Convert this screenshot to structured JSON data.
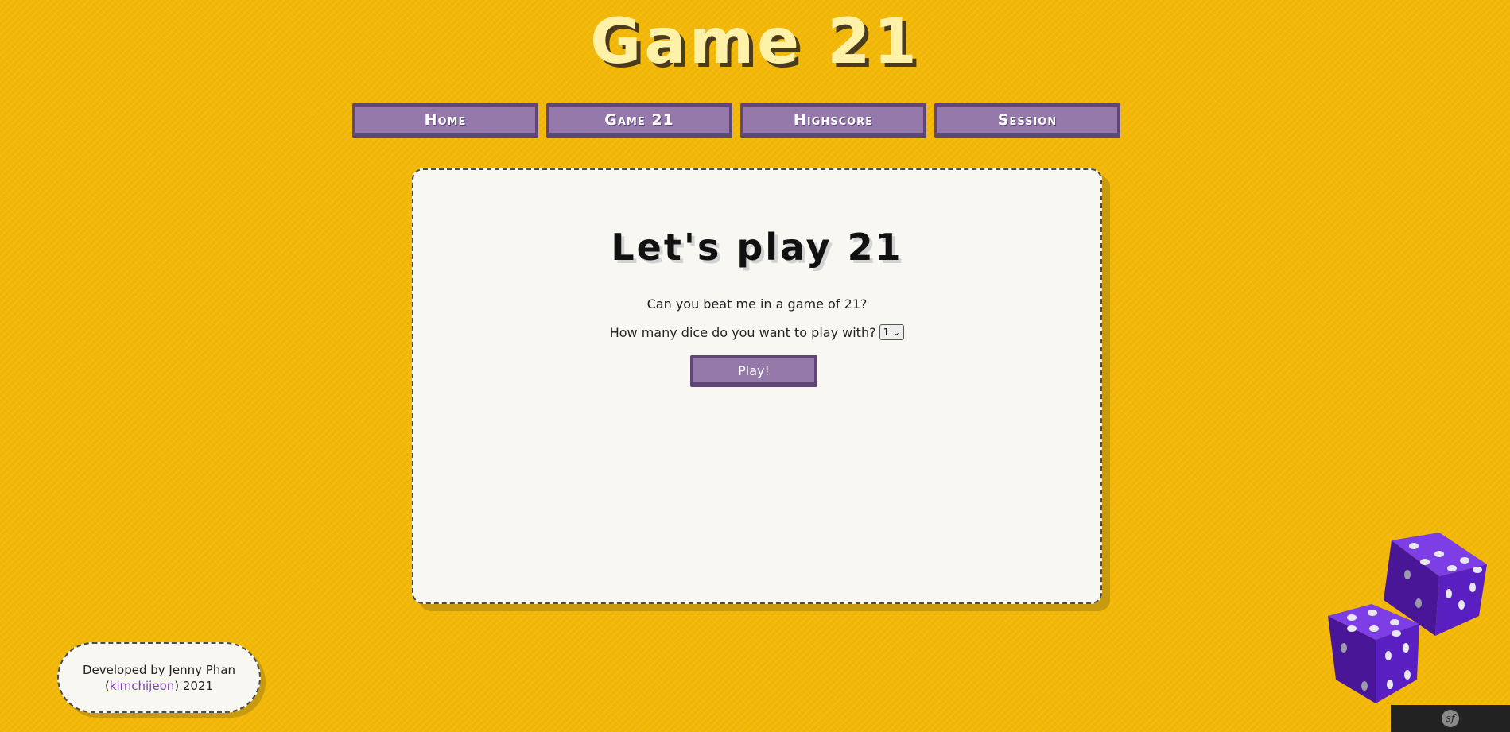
{
  "header": {
    "title": "Game 21"
  },
  "nav": {
    "items": [
      {
        "label": "Home"
      },
      {
        "label": "Game 21"
      },
      {
        "label": "Highscore"
      },
      {
        "label": "Session"
      }
    ]
  },
  "main": {
    "heading": "Let's play 21",
    "intro": "Can you beat me in a game of 21?",
    "dice_prompt": "How many dice do you want to play with?",
    "dice_select": {
      "selected": "1",
      "arrow": "⌄"
    },
    "play_button": "Play!"
  },
  "footer": {
    "line1": "Developed by Jenny Phan",
    "open_paren": "(",
    "link_text": "kimchijeon",
    "close_paren": ") 2021"
  },
  "toolbar": {
    "logo_text": "sf"
  },
  "colors": {
    "background": "#f2b705",
    "title": "#fff1a8",
    "button": "#9579aa",
    "button_border": "#5f4676",
    "card": "#f8f7f2",
    "dice": "#5a1fc0"
  },
  "icons": {
    "dice_decoration": "dice-icon",
    "framework_logo": "symfony-icon"
  }
}
